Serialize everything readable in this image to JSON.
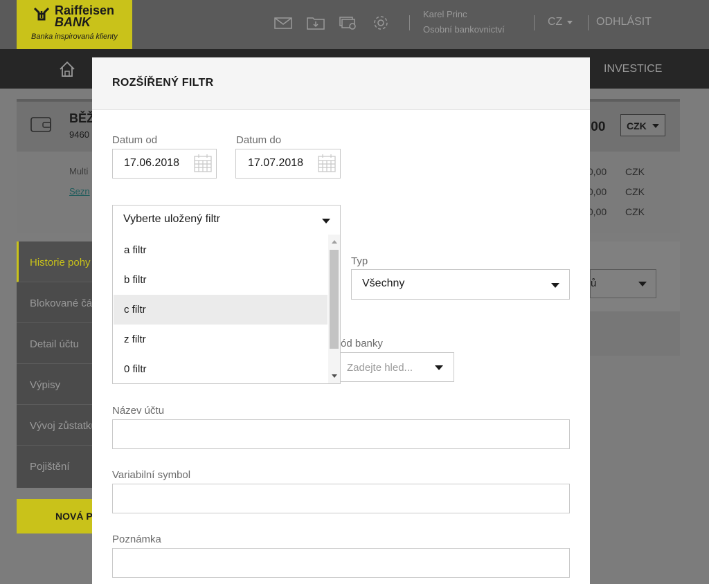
{
  "header": {
    "logo": {
      "line1": "Raiffeisen",
      "line2": "BANK",
      "tagline": "Banka inspirovaná klienty"
    },
    "icons": [
      "mail-icon",
      "download-folder-icon",
      "cards-gear-icon",
      "settings-icon"
    ],
    "user_name": "Karel Princ",
    "user_segment": "Osobní bankovnictví",
    "language": "CZ",
    "logout": "ODHLÁSIT"
  },
  "nav": {
    "home_icon": "home-icon",
    "last_item": "INVESTICE"
  },
  "account": {
    "title": "BĚŽ",
    "number": "9460",
    "balance": ",00",
    "currency": "CZK",
    "row_label": "Multi",
    "link": "Sezn",
    "amounts": [
      {
        "value": ",0,00",
        "currency": "CZK"
      },
      {
        "value": ",0,00",
        "currency": "CZK"
      },
      {
        "value": ",0,00",
        "currency": "CZK"
      }
    ]
  },
  "sidebar": {
    "items": [
      {
        "label": "Historie pohy",
        "active": true
      },
      {
        "label": "Blokované čá",
        "active": false
      },
      {
        "label": "Detail účtu",
        "active": false
      },
      {
        "label": "Výpisy",
        "active": false
      },
      {
        "label": "Vývoj zůstatku",
        "active": false
      },
      {
        "label": "Pojištění",
        "active": false
      }
    ],
    "new_button": "NOVÁ P"
  },
  "right_panel": {
    "select_text": "ů"
  },
  "modal": {
    "title": "ROZŠÍŘENÝ FILTR",
    "date_from_label": "Datum od",
    "date_from": "17.06.2018",
    "date_to_label": "Datum do",
    "date_to": "17.07.2018",
    "saved_filter_placeholder": "Vyberte uložený filtr",
    "saved_filters": [
      "a filtr",
      "b filtr",
      "c filtr",
      "z filtr",
      "0 filtr"
    ],
    "highlighted_index": 2,
    "type_label": "Typ",
    "type_value": "Všechny",
    "bank_code_label": "ód banky",
    "bank_code_placeholder": "Zadejte hled...",
    "account_name_label": "Název účtu",
    "account_name_value": "",
    "variable_symbol_label": "Variabilní symbol",
    "variable_symbol_value": "",
    "note_label": "Poznámka",
    "note_value": ""
  },
  "colors": {
    "brand_yellow": "#c9c21a",
    "overlay": "#7c7c7c",
    "nav_dark": "#262626"
  }
}
